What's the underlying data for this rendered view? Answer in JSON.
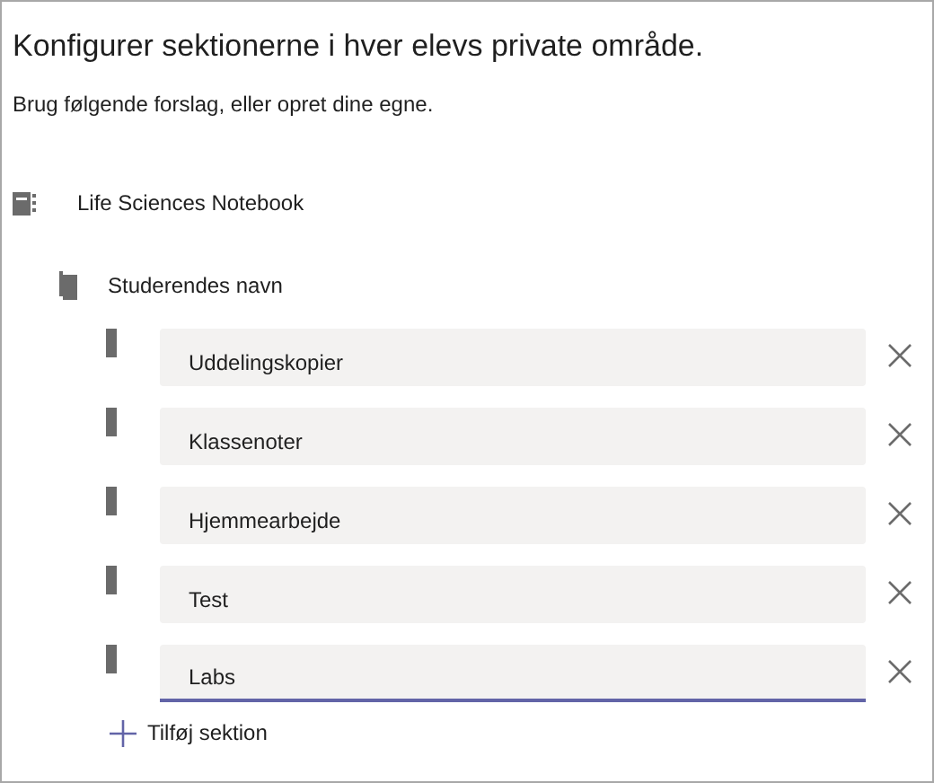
{
  "title": "Konfigurer sektionerne i hver elevs private område.",
  "subtitle": "Brug følgende forslag, eller opret dine egne.",
  "notebook": {
    "label": "Life Sciences Notebook"
  },
  "section_group": {
    "label": "Studerendes navn"
  },
  "sections": [
    {
      "value": "Uddelingskopier",
      "focused": false
    },
    {
      "value": "Klassenoter",
      "focused": false
    },
    {
      "value": "Hjemmearbejde",
      "focused": false
    },
    {
      "value": "Test",
      "focused": false
    },
    {
      "value": "Labs",
      "focused": true
    }
  ],
  "add_button": {
    "label": "Tilføj sektion"
  }
}
